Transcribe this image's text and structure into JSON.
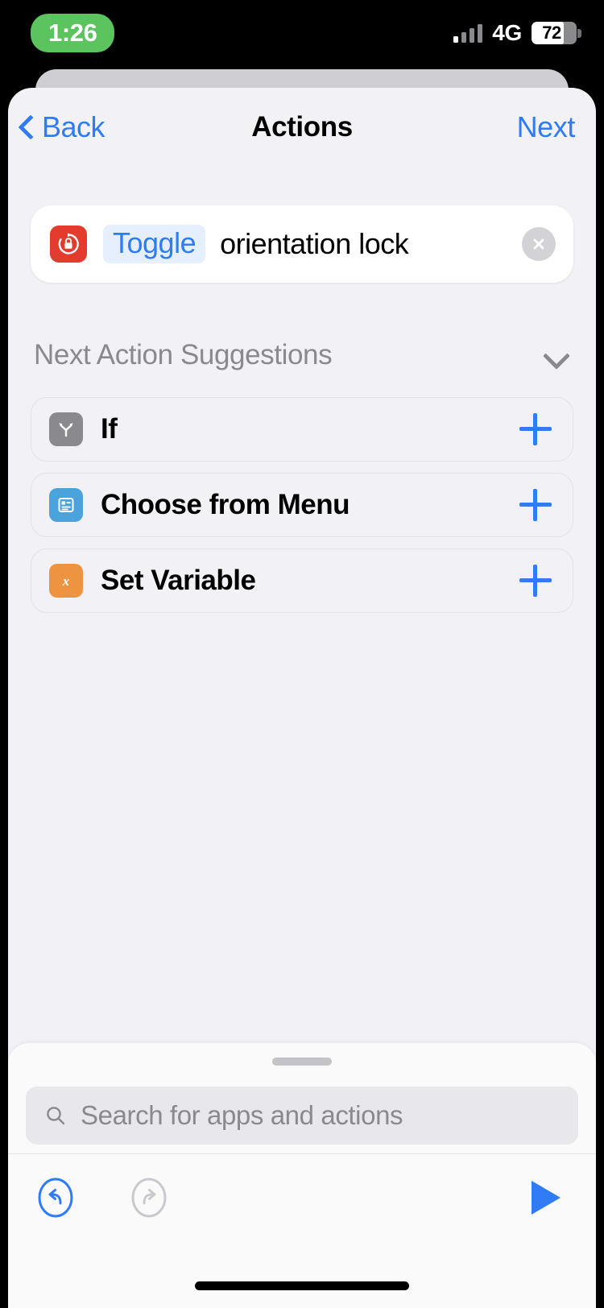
{
  "status_bar": {
    "time": "1:26",
    "time_pill_color": "#5BC45E",
    "network": "4G",
    "battery_percent": "72",
    "signal_icon": "signal-bars-icon"
  },
  "nav": {
    "back_label": "Back",
    "title": "Actions",
    "next_label": "Next",
    "accent_color": "#2F7CF6"
  },
  "action_card": {
    "icon_name": "orientation-lock-icon",
    "icon_color": "#E33B2E",
    "verb": "Toggle",
    "verb_color": "#2F7CF6",
    "verb_bg": "#E5EFFD",
    "text": "orientation lock",
    "close_icon": "close-icon"
  },
  "suggestions": {
    "header": "Next Action Suggestions",
    "header_color": "#8A8A8E",
    "collapse_icon": "chevron-down-icon",
    "items": [
      {
        "label": "If",
        "icon_name": "if-branch-icon",
        "icon_color": "#8A8A8E",
        "add_icon": "plus-icon"
      },
      {
        "label": "Choose from Menu",
        "icon_name": "menu-list-icon",
        "icon_color": "#4BA3DC",
        "add_icon": "plus-icon"
      },
      {
        "label": "Set Variable",
        "icon_name": "variable-x-icon",
        "icon_color": "#EE9440",
        "add_icon": "plus-icon"
      }
    ]
  },
  "bottom_sheet": {
    "drag_handle": "drag-handle",
    "search": {
      "placeholder": "Search for apps and actions",
      "icon_name": "search-icon",
      "value": ""
    }
  },
  "toolbar": {
    "undo": {
      "icon_name": "undo-icon",
      "color": "#2F7CF6",
      "enabled": "true"
    },
    "redo": {
      "icon_name": "redo-icon",
      "color": "#C9C9CE",
      "enabled": "false"
    },
    "play": {
      "icon_name": "play-icon",
      "color": "#2F7CF6",
      "enabled": "true"
    }
  }
}
